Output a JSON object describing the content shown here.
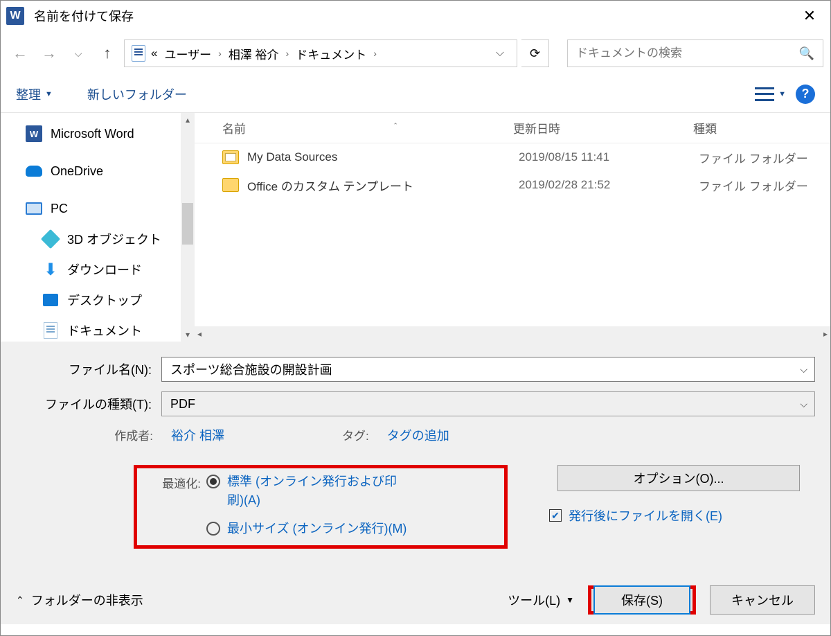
{
  "title": "名前を付けて保存",
  "breadcrumb": {
    "prefix": "«",
    "parts": [
      "ユーザー",
      "相澤 裕介",
      "ドキュメント"
    ]
  },
  "search": {
    "placeholder": "ドキュメントの検索"
  },
  "toolbar": {
    "organize": "整理",
    "new_folder": "新しいフォルダー"
  },
  "sidebar": {
    "items": [
      {
        "label": "Microsoft Word"
      },
      {
        "label": "OneDrive"
      },
      {
        "label": "PC"
      },
      {
        "label": "3D オブジェクト"
      },
      {
        "label": "ダウンロード"
      },
      {
        "label": "デスクトップ"
      },
      {
        "label": "ドキュメント"
      }
    ]
  },
  "columns": {
    "name": "名前",
    "date": "更新日時",
    "type": "種類"
  },
  "rows": [
    {
      "name": "My Data Sources",
      "date": "2019/08/15 11:41",
      "type": "ファイル フォルダー"
    },
    {
      "name": "Office のカスタム テンプレート",
      "date": "2019/02/28 21:52",
      "type": "ファイル フォルダー"
    }
  ],
  "form": {
    "filename_label": "ファイル名(N):",
    "filename_value": "スポーツ総合施設の開設計画",
    "filetype_label": "ファイルの種類(T):",
    "filetype_value": "PDF",
    "author_label": "作成者:",
    "author_value": "裕介 相澤",
    "tag_label": "タグ:",
    "tag_value": "タグの追加"
  },
  "optimize": {
    "label": "最適化:",
    "standard": "標準 (オンライン発行および印刷)(A)",
    "minimum": "最小サイズ (オンライン発行)(M)"
  },
  "options": {
    "button": "オプション(O)...",
    "open_after": "発行後にファイルを開く(E)"
  },
  "bottom": {
    "hide_folders": "フォルダーの非表示",
    "tools": "ツール(L)",
    "save": "保存(S)",
    "cancel": "キャンセル"
  }
}
